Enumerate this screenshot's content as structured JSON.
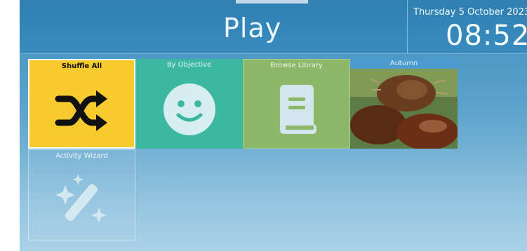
{
  "header": {
    "title": "Play",
    "date": "Thursday 5 October 2023",
    "time": "08:52"
  },
  "tiles": [
    {
      "label": "Shuffle All",
      "icon": "shuffle-icon",
      "color": "#f7cb2d"
    },
    {
      "label": "By Objective",
      "icon": "smiley-icon",
      "color": "#3cb8a0"
    },
    {
      "label": "Browse Library",
      "icon": "book-icon",
      "color": "#8db86a"
    },
    {
      "label": "Autumn",
      "icon": "chestnut-photo",
      "color": "#4b9ad0"
    },
    {
      "label": "Activity Wizard",
      "icon": "magic-wand-icon",
      "color": "#93c4df"
    }
  ]
}
